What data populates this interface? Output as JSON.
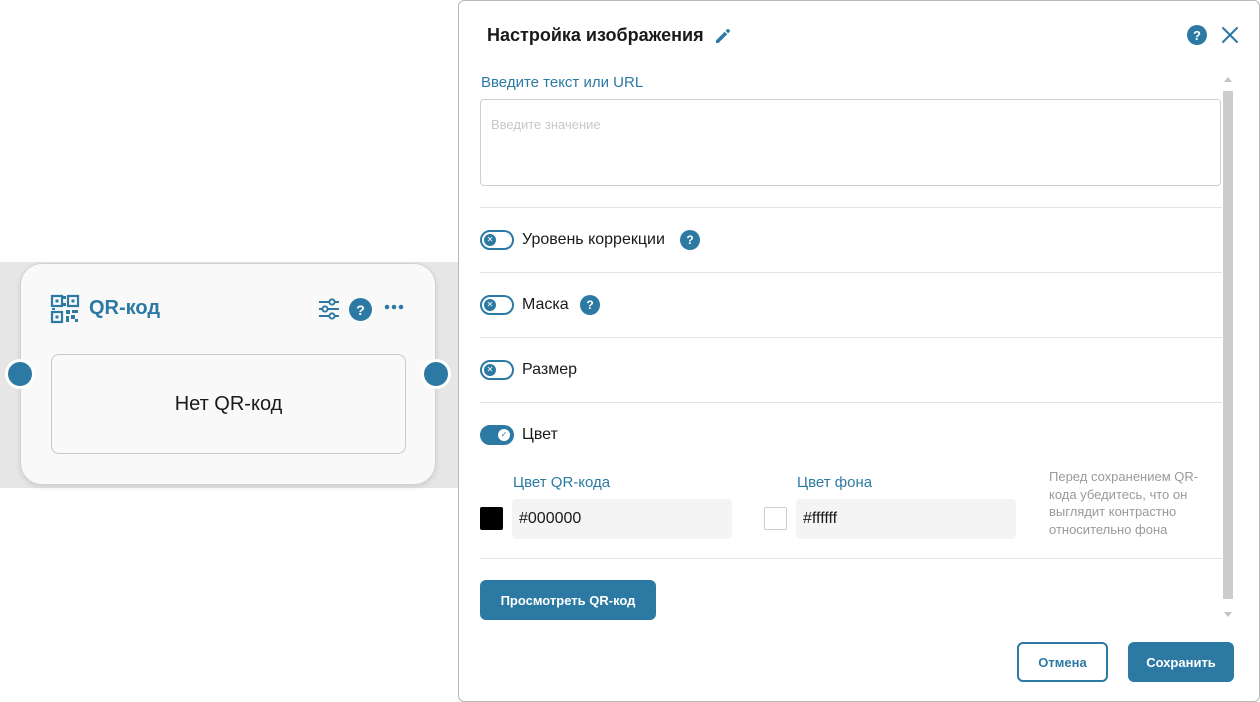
{
  "colors": {
    "accent": "#2c7aa3",
    "canvas_band": "#e6e6e6",
    "qr_color": "#000000",
    "bg_color": "#ffffff"
  },
  "node": {
    "title": "QR-код",
    "empty_text": "Нет QR-код",
    "help_label": "?",
    "icons": [
      "qr-code-icon",
      "sliders-icon",
      "help-icon",
      "more-icon"
    ]
  },
  "dialog": {
    "title": "Настройка изображения",
    "help_label": "?",
    "text_field": {
      "label": "Введите текст или URL",
      "placeholder": "Введите значение",
      "value": ""
    },
    "toggles": [
      {
        "label": "Уровень коррекции",
        "on": false,
        "help": "?"
      },
      {
        "label": "Маска",
        "on": false,
        "help": "?"
      },
      {
        "label": "Размер",
        "on": false
      },
      {
        "label": "Цвет",
        "on": true
      }
    ],
    "color": {
      "qr_label": "Цвет QR-кода",
      "qr_value": "#000000",
      "bg_label": "Цвет фона",
      "bg_value": "#ffffff",
      "hint": "Перед сохранением QR-кода убедитесь, что он выглядит контрастно относительно фона"
    },
    "preview_button": "Просмотреть QR-код",
    "cancel_button": "Отмена",
    "save_button": "Сохранить"
  }
}
